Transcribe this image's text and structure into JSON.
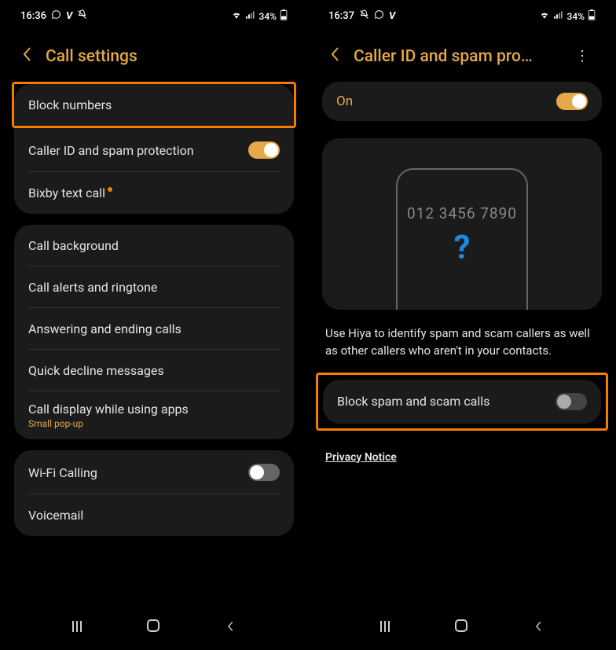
{
  "left": {
    "status": {
      "time": "16:36",
      "icons_left": "⊙ V ⊘",
      "signal": "34%"
    },
    "header": {
      "title": "Call settings"
    },
    "group1": [
      {
        "label": "Block numbers",
        "highlight": true
      },
      {
        "label": "Caller ID and spam protection",
        "toggle": "on"
      },
      {
        "label": "Bixby text call",
        "dot": true
      }
    ],
    "group2": [
      {
        "label": "Call background"
      },
      {
        "label": "Call alerts and ringtone"
      },
      {
        "label": "Answering and ending calls"
      },
      {
        "label": "Quick decline messages"
      },
      {
        "label": "Call display while using apps",
        "sub": "Small pop-up"
      }
    ],
    "group3": [
      {
        "label": "Wi-Fi Calling",
        "toggle": "off"
      },
      {
        "label": "Voicemail"
      }
    ]
  },
  "right": {
    "status": {
      "time": "16:37",
      "icons_left": "⊘ ⊙ V",
      "signal": "34%"
    },
    "header": {
      "title": "Caller ID and spam pro…"
    },
    "on_label": "On",
    "phone_number": "012 3456 7890",
    "question": "?",
    "description": "Use Hiya to identify spam and scam callers as well as other callers who aren't in your contacts.",
    "block_label": "Block spam and scam calls",
    "privacy": "Privacy Notice"
  }
}
